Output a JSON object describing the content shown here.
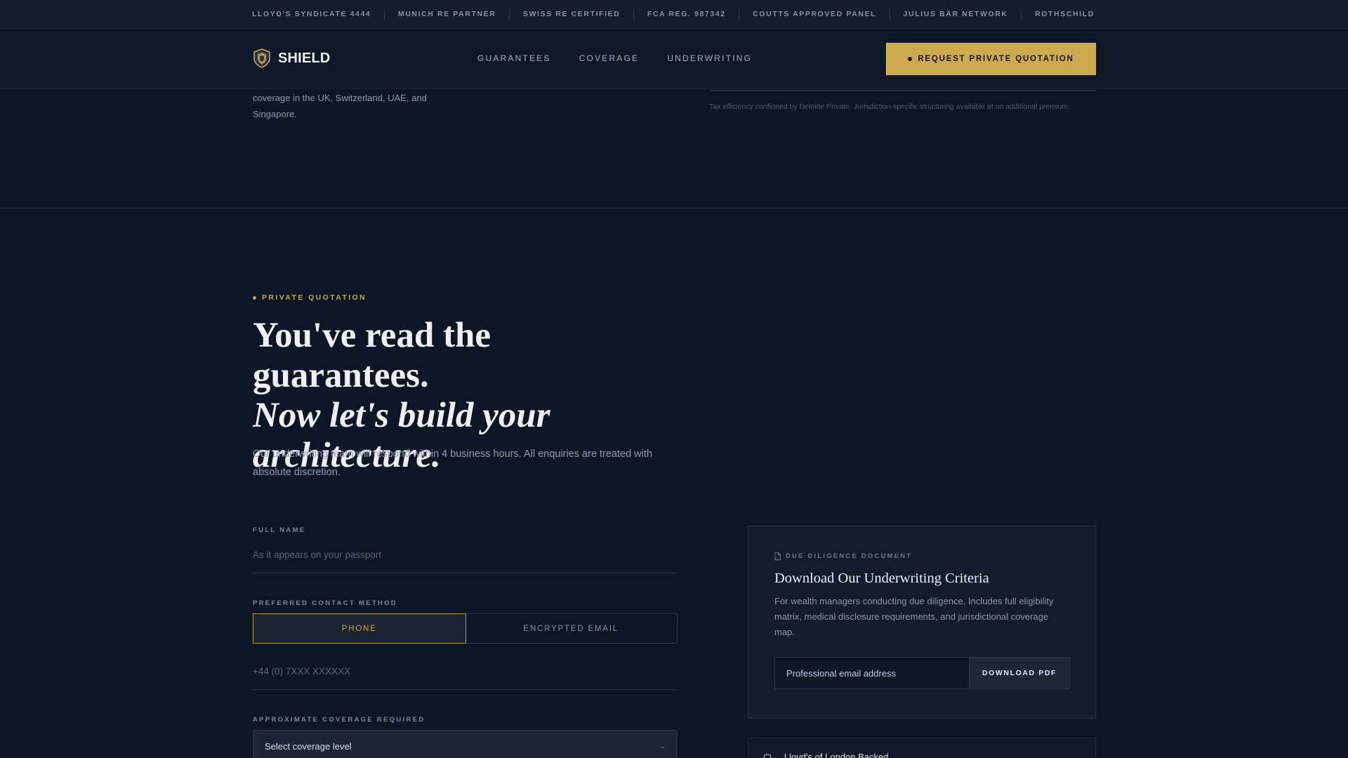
{
  "trustbar": {
    "items": [
      "LLOYD'S SYNDICATE 4444",
      "MUNICH RE PARTNER",
      "SWISS RE CERTIFIED",
      "FCA REG. 987342",
      "COUTTS APPROVED PANEL",
      "JULIUS BÄR NETWORK",
      "ROTHSCHILD"
    ]
  },
  "header": {
    "logo_text": "SHIELD",
    "logo_icon": "shield-icon",
    "nav": [
      "GUARANTEES",
      "COVERAGE",
      "UNDERWRITING"
    ],
    "cta_label": "REQUEST PRIVATE QUOTATION"
  },
  "previous_section": {
    "text": "coverage in the UK, Switzerland, UAE, and Singapore.",
    "note": "Tax efficiency confirmed by Deloitte Private. Jurisdiction-specific structuring available at no additional premium."
  },
  "quotation": {
    "eyebrow": "PRIVATE QUOTATION",
    "heading_line1": "You've read the guarantees.",
    "heading_line2": "Now let's build your architecture.",
    "lead": "Our underwriting team will respond within 4 business hours. All enquiries are treated with absolute discretion."
  },
  "form": {
    "full_name_label": "FULL NAME",
    "full_name_placeholder": "As it appears on your passport",
    "contact_label": "PREFERRED CONTACT METHOD",
    "contact_options": [
      "PHONE",
      "ENCRYPTED EMAIL"
    ],
    "phone_placeholder": "+44 (0) 7XXX XXXXXX",
    "coverage_label": "APPROXIMATE COVERAGE REQUIRED",
    "coverage_value": "Select coverage level"
  },
  "download_card": {
    "eyebrow": "DUE DILIGENCE DOCUMENT",
    "title": "Download Our Underwriting Criteria",
    "text": "For wealth managers conducting due diligence. Includes full eligibility matrix, medical disclosure requirements, and jurisdictional coverage map.",
    "email_placeholder": "Professional email address",
    "button_label": "DOWNLOAD PDF"
  },
  "badge": {
    "text": "Lloyd's of London Backed"
  },
  "colors": {
    "background": "#0b1627",
    "accent_gold": "#cfa94d"
  }
}
